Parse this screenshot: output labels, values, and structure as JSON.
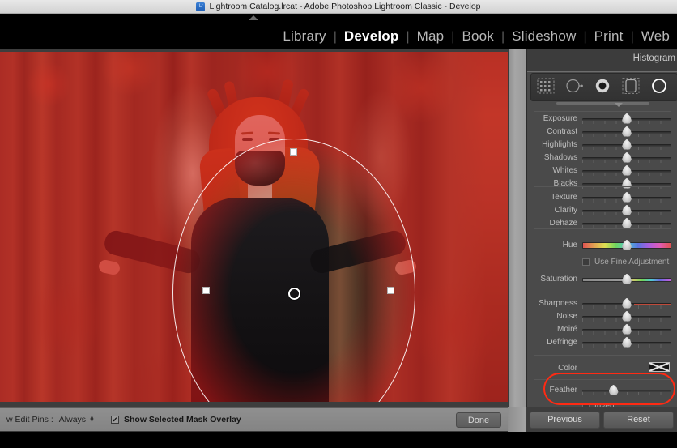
{
  "window": {
    "title": "Lightroom Catalog.lrcat - Adobe Photoshop Lightroom Classic - Develop",
    "app_icon": "lightroom-icon",
    "icon_text": "Lr"
  },
  "modules": {
    "items": [
      {
        "label": "Library",
        "active": false
      },
      {
        "label": "Develop",
        "active": true
      },
      {
        "label": "Map",
        "active": false
      },
      {
        "label": "Book",
        "active": false
      },
      {
        "label": "Slideshow",
        "active": false
      },
      {
        "label": "Print",
        "active": false
      },
      {
        "label": "Web",
        "active": false
      }
    ],
    "separator": "|"
  },
  "right_panel": {
    "histogram_title": "Histogram",
    "mask_tools": [
      {
        "name": "select-subject-tool",
        "selected": false
      },
      {
        "name": "graduated-filter-tool",
        "selected": false
      },
      {
        "name": "radial-filter-tool",
        "selected": false
      },
      {
        "name": "linear-gradient-tool",
        "selected": false
      },
      {
        "name": "radial-gradient-tool",
        "selected": true
      },
      {
        "name": "brush-tool",
        "selected": false
      }
    ],
    "basic_sliders": [
      {
        "label": "Exposure",
        "value": 0,
        "pos": 50
      },
      {
        "label": "Contrast",
        "value": 0,
        "pos": 50
      },
      {
        "label": "Highlights",
        "value": 0,
        "pos": 50
      },
      {
        "label": "Shadows",
        "value": 0,
        "pos": 50
      },
      {
        "label": "Whites",
        "value": 0,
        "pos": 50
      },
      {
        "label": "Blacks",
        "value": 0,
        "pos": 50
      }
    ],
    "texture_sliders": [
      {
        "label": "Texture",
        "value": 0,
        "pos": 50
      },
      {
        "label": "Clarity",
        "value": 0,
        "pos": 50
      },
      {
        "label": "Dehaze",
        "value": 0,
        "pos": 50
      }
    ],
    "hue_slider": {
      "label": "Hue",
      "value": 0,
      "pos": 50
    },
    "fine_adjustment": {
      "label": "Use Fine Adjustment",
      "checked": false
    },
    "saturation_slider": {
      "label": "Saturation",
      "value": 0,
      "pos": 50
    },
    "detail_sliders": [
      {
        "label": "Sharpness",
        "value": 0,
        "pos": 50
      },
      {
        "label": "Noise",
        "value": 0,
        "pos": 50
      },
      {
        "label": "Moiré",
        "value": 0,
        "pos": 50
      },
      {
        "label": "Defringe",
        "value": 0,
        "pos": 50
      }
    ],
    "color_row": {
      "label": "Color",
      "swatch": "none-swatch-x"
    },
    "feather_slider": {
      "label": "Feather",
      "value": 35,
      "pos": 35
    },
    "invert": {
      "label": "Invert",
      "checked": false
    },
    "annotation_color": "#ff2a13"
  },
  "toolbar": {
    "edit_pins_label": "w Edit Pins :",
    "edit_pins_value": "Always",
    "stepper_icon": "stepper-updown-icon",
    "overlay_checkbox": {
      "label": "Show Selected Mask Overlay",
      "checked": true,
      "mark": "✔"
    },
    "done_label": "Done"
  },
  "bottom_buttons": {
    "previous_label": "Previous",
    "reset_label": "Reset"
  },
  "photo": {
    "mask_overlay_color": "#e01b1b",
    "mask_shape": "ellipse",
    "handles": [
      "top",
      "bottom",
      "left",
      "right"
    ],
    "center_pin": "radial-mask-center-pin"
  }
}
